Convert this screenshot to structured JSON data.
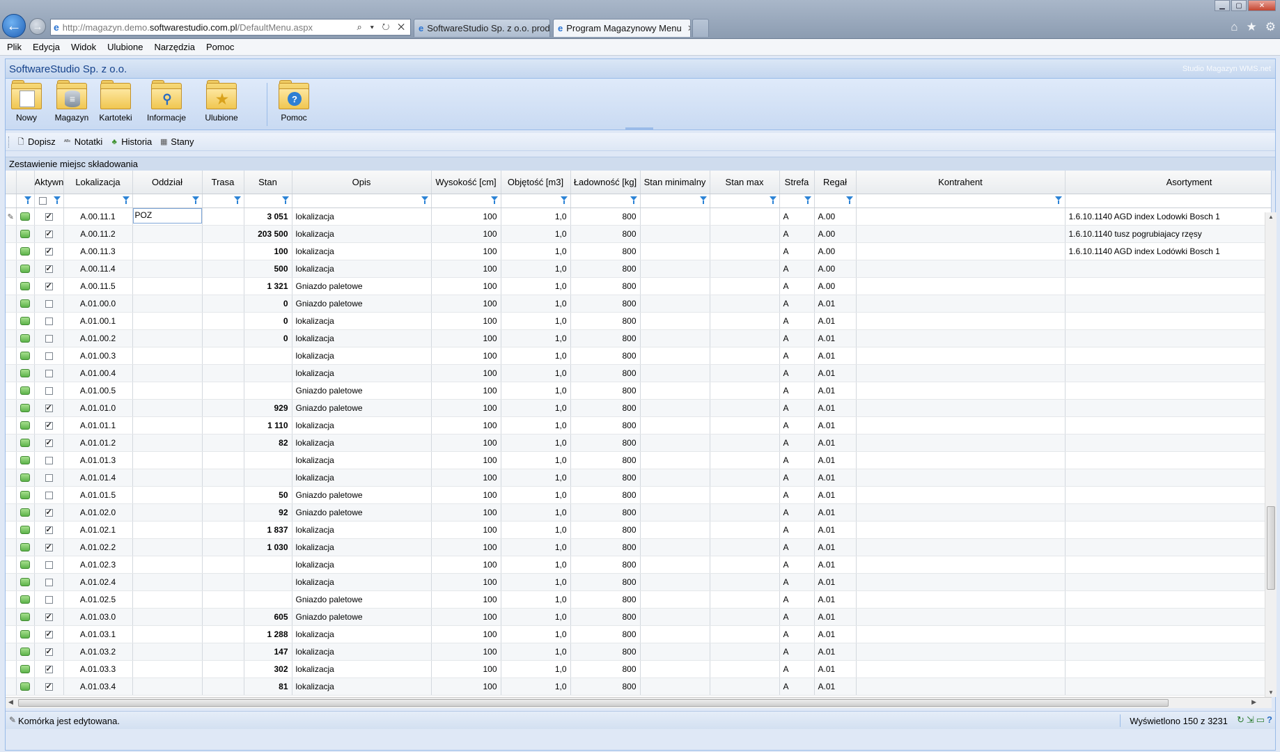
{
  "browser": {
    "url_prefix": "http://magazyn.demo.",
    "url_host": "softwarestudio.com.pl",
    "url_path": "/DefaultMenu.aspx",
    "address_icons": "⌕ ▾ ↻ ✕",
    "tabs": [
      {
        "label": "SoftwareStudio Sp. z o.o. prod..."
      },
      {
        "label": "Program Magazynowy Menu"
      }
    ],
    "tab_close": "✕"
  },
  "menu": {
    "items": [
      "Plik",
      "Edycja",
      "Widok",
      "Ulubione",
      "Narzędzia",
      "Pomoc"
    ]
  },
  "app": {
    "title": "SoftwareStudio Sp. z o.o.",
    "brand": "Studio Magazyn WMS.net"
  },
  "ribbon": {
    "buttons": [
      {
        "label": "Nowy",
        "icon": "new-document-folder-icon"
      },
      {
        "label": "Magazyn",
        "icon": "database-folder-icon"
      },
      {
        "label": "Kartoteki",
        "icon": "folder-icon"
      },
      {
        "label": "Informacje",
        "icon": "search-folder-icon"
      },
      {
        "label": "Ulubione",
        "icon": "favorites-folder-icon"
      },
      {
        "label": "Pomoc",
        "icon": "help-folder-icon"
      }
    ]
  },
  "toolbar": {
    "items": [
      {
        "label": "Dopisz",
        "icon": "add-document-icon"
      },
      {
        "label": "Notatki",
        "icon": "spellcheck-icon"
      },
      {
        "label": "Historia",
        "icon": "history-icon"
      },
      {
        "label": "Stany",
        "icon": "table-icon"
      }
    ]
  },
  "grid": {
    "title": "Zestawienie miejsc składowania",
    "columns": [
      "Aktywne",
      "Lokalizacja",
      "Oddział",
      "Trasa",
      "Stan",
      "Opis",
      "Wysokość [cm]",
      "Objętość [m3]",
      "Ładowność [kg]",
      "Stan minimalny",
      "Stan max",
      "Strefa",
      "Regał",
      "Kontrahent",
      "Asortyment"
    ],
    "editing_value": "POZ",
    "rows": [
      {
        "aktywne": true,
        "lok": "A.00.11.1",
        "stan": "3 051",
        "opis": "lokalizacja",
        "wys": "100",
        "obj": "1,0",
        "lad": "800",
        "strefa": "A",
        "regal": "A.00",
        "asort": "1.6.10.1140 AGD index Lodowki Bosch 1"
      },
      {
        "aktywne": true,
        "lok": "A.00.11.2",
        "stan": "203 500",
        "opis": "lokalizacja",
        "wys": "100",
        "obj": "1,0",
        "lad": "800",
        "strefa": "A",
        "regal": "A.00",
        "asort": "1.6.10.1140 tusz pogrubiajacy rzęsy"
      },
      {
        "aktywne": true,
        "lok": "A.00.11.3",
        "stan": "100",
        "opis": "lokalizacja",
        "wys": "100",
        "obj": "1,0",
        "lad": "800",
        "strefa": "A",
        "regal": "A.00",
        "asort": "1.6.10.1140 AGD index Lodówki Bosch 1"
      },
      {
        "aktywne": true,
        "lok": "A.00.11.4",
        "stan": "500",
        "opis": "lokalizacja",
        "wys": "100",
        "obj": "1,0",
        "lad": "800",
        "strefa": "A",
        "regal": "A.00",
        "asort": ""
      },
      {
        "aktywne": true,
        "lok": "A.00.11.5",
        "stan": "1 321",
        "opis": "Gniazdo paletowe",
        "wys": "100",
        "obj": "1,0",
        "lad": "800",
        "strefa": "A",
        "regal": "A.00",
        "asort": ""
      },
      {
        "aktywne": false,
        "lok": "A.01.00.0",
        "stan": "0",
        "opis": "Gniazdo paletowe",
        "wys": "100",
        "obj": "1,0",
        "lad": "800",
        "strefa": "A",
        "regal": "A.01",
        "asort": ""
      },
      {
        "aktywne": false,
        "lok": "A.01.00.1",
        "stan": "0",
        "opis": "lokalizacja",
        "wys": "100",
        "obj": "1,0",
        "lad": "800",
        "strefa": "A",
        "regal": "A.01",
        "asort": ""
      },
      {
        "aktywne": false,
        "lok": "A.01.00.2",
        "stan": "0",
        "opis": "lokalizacja",
        "wys": "100",
        "obj": "1,0",
        "lad": "800",
        "strefa": "A",
        "regal": "A.01",
        "asort": ""
      },
      {
        "aktywne": false,
        "lok": "A.01.00.3",
        "stan": "",
        "opis": "lokalizacja",
        "wys": "100",
        "obj": "1,0",
        "lad": "800",
        "strefa": "A",
        "regal": "A.01",
        "asort": ""
      },
      {
        "aktywne": false,
        "lok": "A.01.00.4",
        "stan": "",
        "opis": "lokalizacja",
        "wys": "100",
        "obj": "1,0",
        "lad": "800",
        "strefa": "A",
        "regal": "A.01",
        "asort": ""
      },
      {
        "aktywne": false,
        "lok": "A.01.00.5",
        "stan": "",
        "opis": "Gniazdo paletowe",
        "wys": "100",
        "obj": "1,0",
        "lad": "800",
        "strefa": "A",
        "regal": "A.01",
        "asort": ""
      },
      {
        "aktywne": true,
        "lok": "A.01.01.0",
        "stan": "929",
        "opis": "Gniazdo paletowe",
        "wys": "100",
        "obj": "1,0",
        "lad": "800",
        "strefa": "A",
        "regal": "A.01",
        "asort": ""
      },
      {
        "aktywne": true,
        "lok": "A.01.01.1",
        "stan": "1 110",
        "opis": "lokalizacja",
        "wys": "100",
        "obj": "1,0",
        "lad": "800",
        "strefa": "A",
        "regal": "A.01",
        "asort": ""
      },
      {
        "aktywne": true,
        "lok": "A.01.01.2",
        "stan": "82",
        "opis": "lokalizacja",
        "wys": "100",
        "obj": "1,0",
        "lad": "800",
        "strefa": "A",
        "regal": "A.01",
        "asort": ""
      },
      {
        "aktywne": false,
        "lok": "A.01.01.3",
        "stan": "",
        "opis": "lokalizacja",
        "wys": "100",
        "obj": "1,0",
        "lad": "800",
        "strefa": "A",
        "regal": "A.01",
        "asort": ""
      },
      {
        "aktywne": false,
        "lok": "A.01.01.4",
        "stan": "",
        "opis": "lokalizacja",
        "wys": "100",
        "obj": "1,0",
        "lad": "800",
        "strefa": "A",
        "regal": "A.01",
        "asort": ""
      },
      {
        "aktywne": false,
        "lok": "A.01.01.5",
        "stan": "50",
        "opis": "Gniazdo paletowe",
        "wys": "100",
        "obj": "1,0",
        "lad": "800",
        "strefa": "A",
        "regal": "A.01",
        "asort": ""
      },
      {
        "aktywne": true,
        "lok": "A.01.02.0",
        "stan": "92",
        "opis": "Gniazdo paletowe",
        "wys": "100",
        "obj": "1,0",
        "lad": "800",
        "strefa": "A",
        "regal": "A.01",
        "asort": ""
      },
      {
        "aktywne": true,
        "lok": "A.01.02.1",
        "stan": "1 837",
        "opis": "lokalizacja",
        "wys": "100",
        "obj": "1,0",
        "lad": "800",
        "strefa": "A",
        "regal": "A.01",
        "asort": ""
      },
      {
        "aktywne": true,
        "lok": "A.01.02.2",
        "stan": "1 030",
        "opis": "lokalizacja",
        "wys": "100",
        "obj": "1,0",
        "lad": "800",
        "strefa": "A",
        "regal": "A.01",
        "asort": ""
      },
      {
        "aktywne": false,
        "lok": "A.01.02.3",
        "stan": "",
        "opis": "lokalizacja",
        "wys": "100",
        "obj": "1,0",
        "lad": "800",
        "strefa": "A",
        "regal": "A.01",
        "asort": ""
      },
      {
        "aktywne": false,
        "lok": "A.01.02.4",
        "stan": "",
        "opis": "lokalizacja",
        "wys": "100",
        "obj": "1,0",
        "lad": "800",
        "strefa": "A",
        "regal": "A.01",
        "asort": ""
      },
      {
        "aktywne": false,
        "lok": "A.01.02.5",
        "stan": "",
        "opis": "Gniazdo paletowe",
        "wys": "100",
        "obj": "1,0",
        "lad": "800",
        "strefa": "A",
        "regal": "A.01",
        "asort": ""
      },
      {
        "aktywne": true,
        "lok": "A.01.03.0",
        "stan": "605",
        "opis": "Gniazdo paletowe",
        "wys": "100",
        "obj": "1,0",
        "lad": "800",
        "strefa": "A",
        "regal": "A.01",
        "asort": ""
      },
      {
        "aktywne": true,
        "lok": "A.01.03.1",
        "stan": "1 288",
        "opis": "lokalizacja",
        "wys": "100",
        "obj": "1,0",
        "lad": "800",
        "strefa": "A",
        "regal": "A.01",
        "asort": ""
      },
      {
        "aktywne": true,
        "lok": "A.01.03.2",
        "stan": "147",
        "opis": "lokalizacja",
        "wys": "100",
        "obj": "1,0",
        "lad": "800",
        "strefa": "A",
        "regal": "A.01",
        "asort": ""
      },
      {
        "aktywne": true,
        "lok": "A.01.03.3",
        "stan": "302",
        "opis": "lokalizacja",
        "wys": "100",
        "obj": "1,0",
        "lad": "800",
        "strefa": "A",
        "regal": "A.01",
        "asort": ""
      },
      {
        "aktywne": true,
        "lok": "A.01.03.4",
        "stan": "81",
        "opis": "lokalizacja",
        "wys": "100",
        "obj": "1,0",
        "lad": "800",
        "strefa": "A",
        "regal": "A.01",
        "asort": ""
      }
    ]
  },
  "status": {
    "text": "Komórka jest edytowana.",
    "count": "Wyświetlono 150 z 3231"
  },
  "colors": {
    "panel_border": "#99bbe8",
    "header_text": "#15428b",
    "active_indicator": "#5db34a"
  }
}
